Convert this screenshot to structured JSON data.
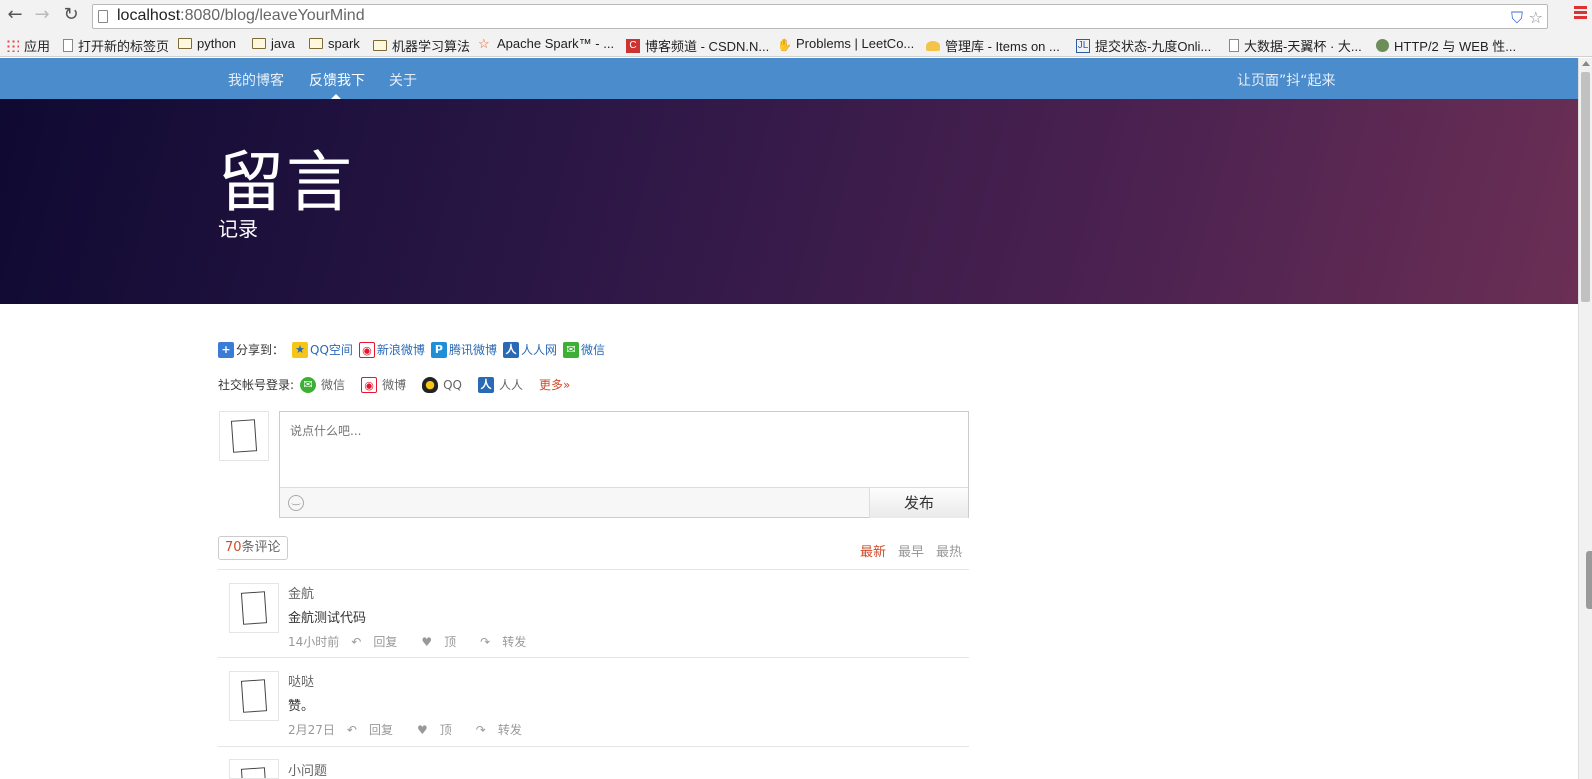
{
  "browser": {
    "url_host": "localhost",
    "url_rest": ":8080/blog/leaveYourMind",
    "bookmarks": [
      {
        "label": "应用",
        "icon": "apps-icon"
      },
      {
        "label": "打开新的标签页",
        "icon": "page-icon"
      },
      {
        "label": "python",
        "icon": "folder-icon"
      },
      {
        "label": "java",
        "icon": "folder-icon"
      },
      {
        "label": "spark",
        "icon": "folder-icon"
      },
      {
        "label": "机器学习算法",
        "icon": "folder-icon"
      },
      {
        "label": "Apache Spark™ - ...",
        "icon": "spark-icon"
      },
      {
        "label": "博客频道 - CSDN.N...",
        "icon": "csdn-icon"
      },
      {
        "label": "Problems | LeetCo...",
        "icon": "leetcode-icon"
      },
      {
        "label": "管理库 - Items on ...",
        "icon": "site-icon"
      },
      {
        "label": "提交状态-九度Onli...",
        "icon": "jiudu-icon"
      },
      {
        "label": "大数据-天翼杯 · 大...",
        "icon": "page-icon"
      },
      {
        "label": "HTTP/2 与 WEB 性...",
        "icon": "avatar-icon"
      }
    ]
  },
  "nav": {
    "items": [
      "我的博客",
      "反馈我下",
      "关于"
    ],
    "right": "让页面”抖“起来"
  },
  "hero": {
    "title": "留言",
    "subtitle": "记录"
  },
  "share": {
    "label": "分享到：",
    "items": [
      "QQ空间",
      "新浪微博",
      "腾讯微博",
      "人人网",
      "微信"
    ]
  },
  "login": {
    "label": "社交帐号登录:",
    "items": [
      "微信",
      "微博",
      "QQ",
      "人人"
    ],
    "more": "更多»"
  },
  "comment_box": {
    "placeholder": "说点什么吧...",
    "post_label": "发布"
  },
  "comments_header": {
    "count": "70",
    "count_suffix": "条评论",
    "sort": [
      "最新",
      "最早",
      "最热"
    ]
  },
  "comments": [
    {
      "name": "金航",
      "text": "金航测试代码",
      "time": "14小时前",
      "reply": "回复",
      "like": "顶",
      "share": "转发"
    },
    {
      "name": "哒哒",
      "text": "赞。",
      "time": "2月27日",
      "reply": "回复",
      "like": "顶",
      "share": "转发"
    },
    {
      "name": "小问题",
      "text": "",
      "time": "",
      "reply": "",
      "like": "",
      "share": ""
    }
  ],
  "colors": {
    "nav_bg": "#4a8ccc",
    "accent_red": "#d04a2a",
    "link_blue": "#2a6ab5"
  }
}
